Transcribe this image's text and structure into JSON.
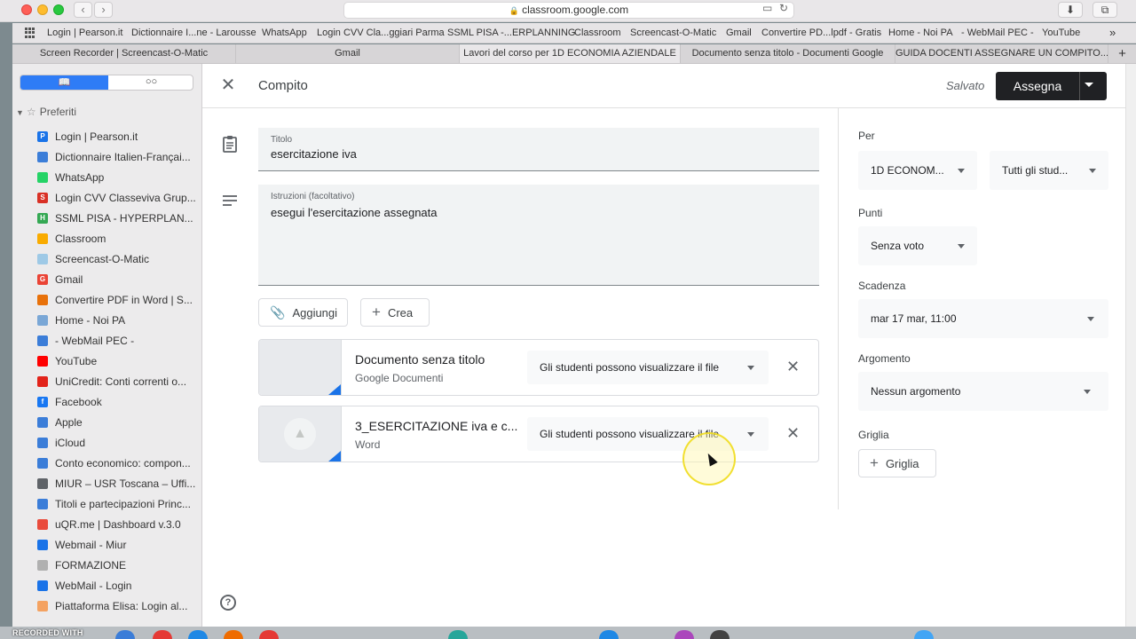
{
  "browser": {
    "url": "classroom.google.com",
    "bookmarks": [
      "Login | Pearson.it",
      "Dictionnaire I...ne - Larousse",
      "WhatsApp",
      "Login CVV Cla...ggiari Parma",
      "SSML PISA -...ERPLANNING",
      "Classroom",
      "Screencast-O-Matic",
      "Gmail",
      "Convertire PD...lpdf - Gratis",
      "Home - Noi PA",
      "- WebMail PEC -",
      "YouTube"
    ],
    "more_bookmarks": "»",
    "tabs": [
      "Screen Recorder | Screencast-O-Matic",
      "Gmail",
      "Lavori del corso per 1D ECONOMIA AZIENDALE",
      "Documento senza titolo - Documenti Google",
      "GUIDA DOCENTI ASSEGNARE UN COMPITO..."
    ],
    "new_tab": "+"
  },
  "sidebar": {
    "section_title": "Preferiti",
    "items": [
      {
        "label": "Login | Pearson.it",
        "color": "#1a73e8",
        "glyph": "P"
      },
      {
        "label": "Dictionnaire Italien-Françai...",
        "color": "#3b7dd8",
        "glyph": ""
      },
      {
        "label": "WhatsApp",
        "color": "#25d366",
        "glyph": ""
      },
      {
        "label": "Login CVV Classeviva Grup...",
        "color": "#d93025",
        "glyph": "S"
      },
      {
        "label": "SSML PISA - HYPERPLAN...",
        "color": "#34a853",
        "glyph": "H"
      },
      {
        "label": "Classroom",
        "color": "#f9ab00",
        "glyph": ""
      },
      {
        "label": "Screencast-O-Matic",
        "color": "#9ec9e6",
        "glyph": ""
      },
      {
        "label": "Gmail",
        "color": "#ea4335",
        "glyph": "G"
      },
      {
        "label": "Convertire PDF in Word | S...",
        "color": "#e8710a",
        "glyph": ""
      },
      {
        "label": "Home - Noi PA",
        "color": "#7aa7d6",
        "glyph": ""
      },
      {
        "label": "- WebMail PEC -",
        "color": "#3b7dd8",
        "glyph": ""
      },
      {
        "label": "YouTube",
        "color": "#ff0000",
        "glyph": ""
      },
      {
        "label": "UniCredit: Conti correnti o...",
        "color": "#e2231a",
        "glyph": ""
      },
      {
        "label": "Facebook",
        "color": "#1877f2",
        "glyph": "f"
      },
      {
        "label": "Apple",
        "color": "#3b7dd8",
        "glyph": ""
      },
      {
        "label": "iCloud",
        "color": "#3b7dd8",
        "glyph": ""
      },
      {
        "label": "Conto economico: compon...",
        "color": "#3b7dd8",
        "glyph": ""
      },
      {
        "label": "MIUR – USR Toscana – Uffi...",
        "color": "#5f6368",
        "glyph": ""
      },
      {
        "label": "Titoli e partecipazioni Princ...",
        "color": "#3b7dd8",
        "glyph": ""
      },
      {
        "label": "uQR.me | Dashboard v.3.0",
        "color": "#e94b3c",
        "glyph": ""
      },
      {
        "label": "Webmail - Miur",
        "color": "#1a73e8",
        "glyph": ""
      },
      {
        "label": "FORMAZIONE",
        "color": "#b0b0b0",
        "glyph": ""
      },
      {
        "label": "WebMail - Login",
        "color": "#1a73e8",
        "glyph": ""
      },
      {
        "label": "Piattaforma Elisa: Login al...",
        "color": "#f4a261",
        "glyph": ""
      }
    ]
  },
  "header": {
    "title": "Compito",
    "saved": "Salvato",
    "assign_label": "Assegna"
  },
  "form": {
    "title_label": "Titolo",
    "title_value": "esercitazione iva",
    "instructions_label": "Istruzioni (facoltativo)",
    "instructions_value": "esegui l'esercitazione assegnata",
    "add_label": "Aggiungi",
    "create_label": "Crea"
  },
  "attachments": [
    {
      "title": "Documento senza titolo",
      "subtitle": "Google Documenti",
      "permission": "Gli studenti possono visualizzare il file"
    },
    {
      "title": "3_ESERCITAZIONE iva e c...",
      "subtitle": "Word",
      "permission": "Gli studenti possono visualizzare il file"
    }
  ],
  "settings": {
    "for_label": "Per",
    "class_value": "1D ECONOM...",
    "students_value": "Tutti gli stud...",
    "points_label": "Punti",
    "points_value": "Senza voto",
    "due_label": "Scadenza",
    "due_value": "mar 17 mar, 11:00",
    "topic_label": "Argomento",
    "topic_value": "Nessun argomento",
    "rubric_label": "Griglia",
    "rubric_button": "Griglia"
  },
  "watermark": "RECORDED WITH"
}
